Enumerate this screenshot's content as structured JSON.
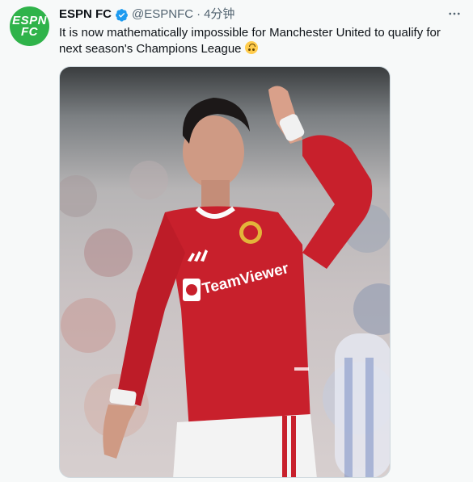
{
  "account": {
    "display_name": "ESPN FC",
    "handle": "@ESPNFC",
    "separator": "·",
    "timestamp": "4分钟",
    "avatar_lines": [
      "ESPN",
      "FC"
    ],
    "avatar_color": "#2fb34a",
    "verified_color": "#1d9bf0"
  },
  "tweet": {
    "text": "It is now mathematically impossible for Manchester United to qualify for next season's Champions League",
    "emoji": "upside-down-face"
  },
  "media": {
    "jersey_text": "TeamViewer",
    "jersey_color": "#c8202c"
  },
  "icons": {
    "more": "more-options-icon",
    "verified": "verified-badge-icon"
  }
}
